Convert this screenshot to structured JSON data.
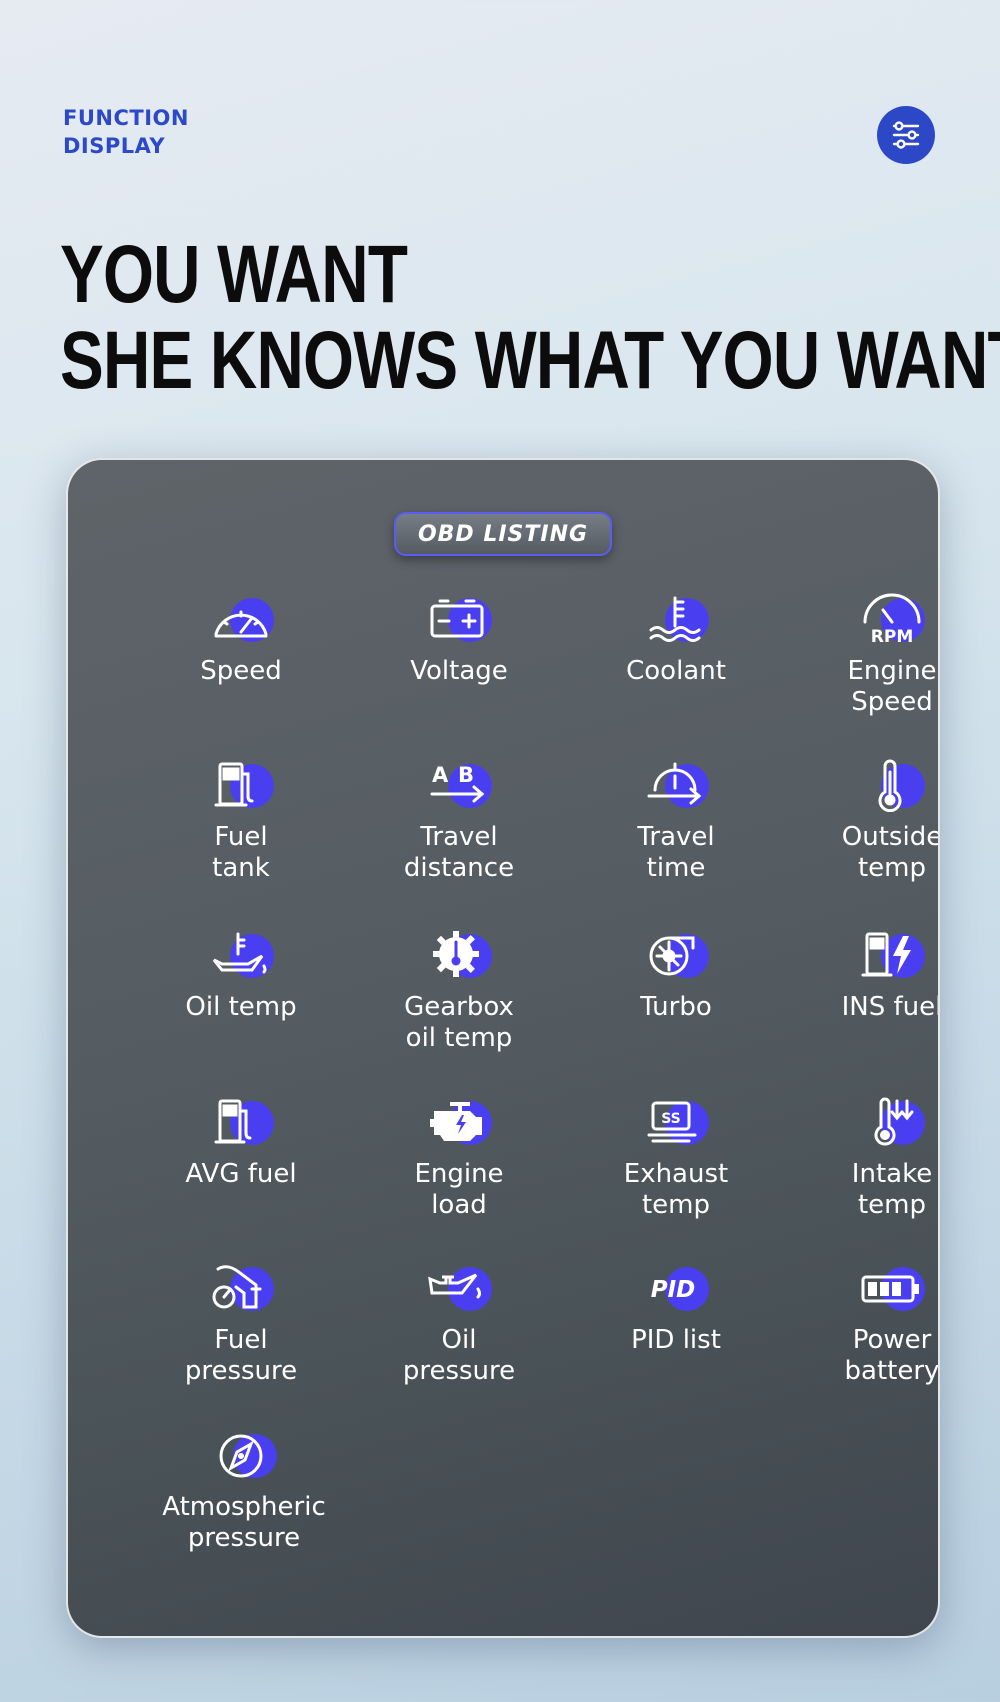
{
  "header": {
    "label_line1": "FUNCTION",
    "label_line2": "DISPLAY",
    "settings_icon": "sliders-icon",
    "accent_color": "#2c48c6"
  },
  "headline": {
    "line1": "YOU WANT",
    "line2": "SHE KNOWS WHAT YOU WANT"
  },
  "panel": {
    "badge": "OBD LISTING",
    "icon_accent": "#4a3ff0",
    "items": [
      {
        "label": "Speed",
        "icon": "speedometer-icon"
      },
      {
        "label": "Voltage",
        "icon": "battery-plus-minus-icon"
      },
      {
        "label": "Coolant",
        "icon": "coolant-temperature-icon"
      },
      {
        "label": "Engine\nSpeed",
        "icon": "rpm-gauge-icon"
      },
      {
        "label": "Fuel\ntank",
        "icon": "fuel-pump-icon"
      },
      {
        "label": "Travel\ndistance",
        "icon": "a-to-b-arrow-icon"
      },
      {
        "label": "Travel\ntime",
        "icon": "timer-arrow-icon"
      },
      {
        "label": "Outside\ntemp",
        "icon": "thermometer-icon"
      },
      {
        "label": "Oil temp",
        "icon": "oil-can-thermometer-icon"
      },
      {
        "label": "Gearbox\noil temp",
        "icon": "gear-thermometer-icon"
      },
      {
        "label": "Turbo",
        "icon": "turbocharger-icon"
      },
      {
        "label": "INS fuel",
        "icon": "fuel-pump-lightning-icon"
      },
      {
        "label": "AVG fuel",
        "icon": "fuel-station-icon"
      },
      {
        "label": "Engine\nload",
        "icon": "engine-icon"
      },
      {
        "label": "Exhaust\ntemp",
        "icon": "exhaust-icon"
      },
      {
        "label": "Intake\ntemp",
        "icon": "intake-thermometer-icon"
      },
      {
        "label": "Fuel\npressure",
        "icon": "fuel-nozzle-gauge-icon"
      },
      {
        "label": "Oil\npressure",
        "icon": "oil-can-icon"
      },
      {
        "label": "PID list",
        "icon": "pid-icon"
      },
      {
        "label": "Power\nbattery",
        "icon": "battery-level-icon"
      },
      {
        "label": "Atmospheric\npressure",
        "icon": "compass-gauge-icon"
      }
    ]
  }
}
